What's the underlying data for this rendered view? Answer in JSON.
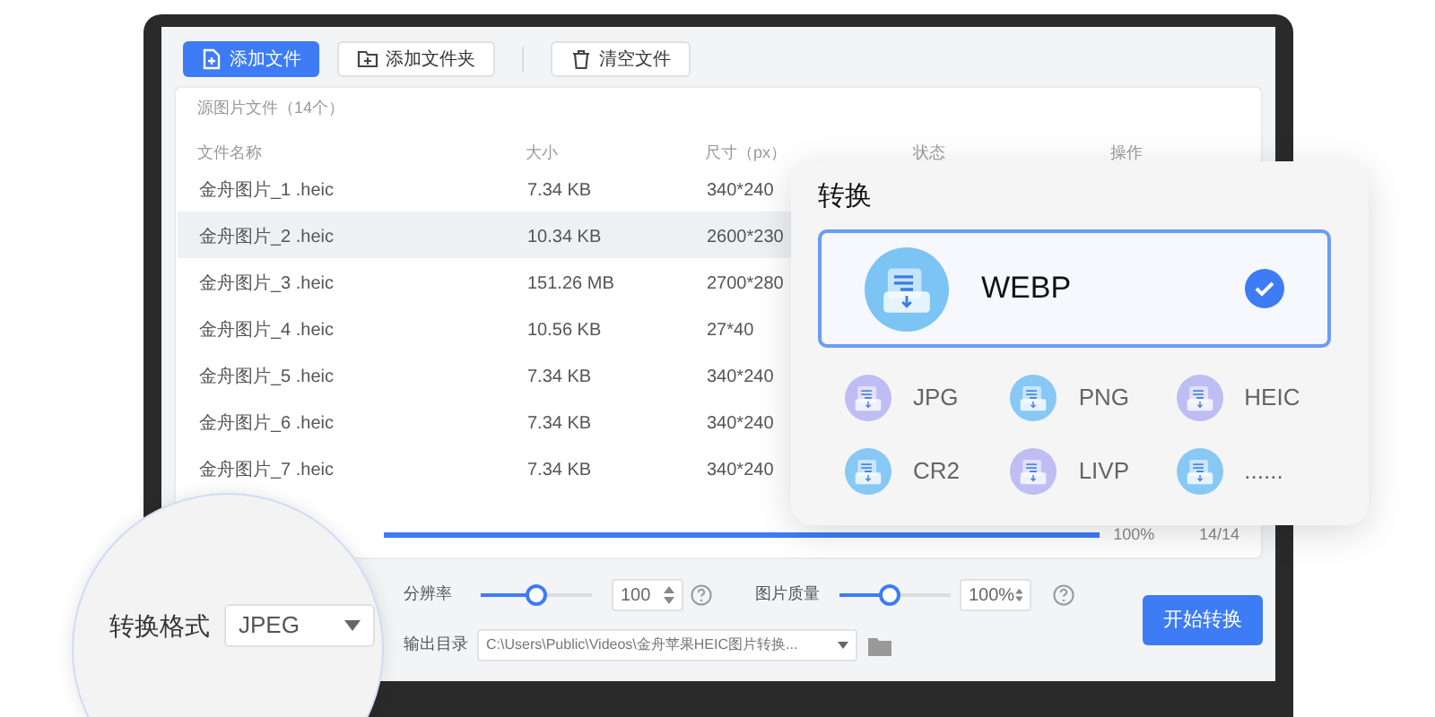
{
  "toolbar": {
    "buttons": [
      {
        "label": "添加文件",
        "kind": "add-file"
      },
      {
        "label": "添加文件夹",
        "kind": "add-folder"
      },
      {
        "label": "清空文件",
        "kind": "clear"
      }
    ]
  },
  "file_list": {
    "title": "源图片文件（14个）",
    "columns": [
      "文件名称",
      "大小",
      "尺寸（px）",
      "状态",
      "操作"
    ],
    "rows": [
      {
        "name": "金舟图片_1 .heic",
        "size": "7.34 KB",
        "dimensions": "340*240",
        "selected": false
      },
      {
        "name": "金舟图片_2 .heic",
        "size": "10.34 KB",
        "dimensions": "2600*230",
        "selected": true
      },
      {
        "name": "金舟图片_3 .heic",
        "size": "151.26 MB",
        "dimensions": "2700*280",
        "selected": false
      },
      {
        "name": "金舟图片_4 .heic",
        "size": "10.56 KB",
        "dimensions": "27*40",
        "selected": false
      },
      {
        "name": "金舟图片_5 .heic",
        "size": "7.34 KB",
        "dimensions": "340*240",
        "selected": false
      },
      {
        "name": "金舟图片_6 .heic",
        "size": "7.34 KB",
        "dimensions": "340*240",
        "selected": false
      },
      {
        "name": "金舟图片_7 .heic",
        "size": "7.34 KB",
        "dimensions": "340*240",
        "selected": false
      }
    ]
  },
  "progress": {
    "level": 1,
    "percent": "100%",
    "count": "14/14"
  },
  "settings": {
    "resolution": {
      "label": "分辨率",
      "level": 0.5,
      "value": "100"
    },
    "quality": {
      "label": "图片质量",
      "level": 0.45,
      "value": "100%"
    },
    "output": {
      "label": "输出目录",
      "path": "C:\\Users\\Public\\Videos\\金舟苹果HEIC图片转换..."
    },
    "start_button": "开始转换"
  },
  "magnifier": {
    "label": "转换格式",
    "value": "JPEG"
  },
  "convert_popup": {
    "title": "转换",
    "formats": [
      {
        "label": "WEBP",
        "selected": true,
        "color": "#7cc4f4"
      },
      {
        "label": "JPG",
        "selected": false,
        "color": "#b9b9f4"
      },
      {
        "label": "PNG",
        "selected": false,
        "color": "#7cc4f4"
      },
      {
        "label": "HEIC",
        "selected": false,
        "color": "#b9b9f4"
      },
      {
        "label": "CR2",
        "selected": false,
        "color": "#7cc4f4"
      },
      {
        "label": "LIVP",
        "selected": false,
        "color": "#b9b9f4"
      },
      {
        "label": "......",
        "selected": false,
        "color": "#7cc4f4"
      }
    ]
  }
}
